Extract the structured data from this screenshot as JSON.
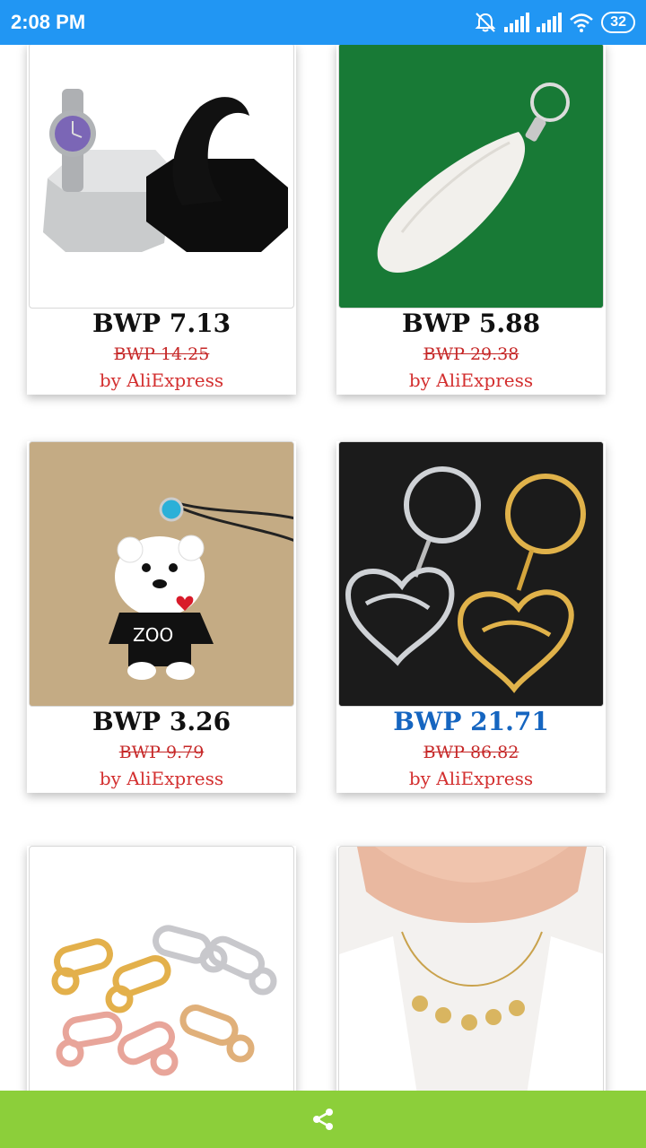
{
  "status_bar": {
    "time": "2:08 PM",
    "battery": "32",
    "icons": [
      "alarm-off-icon",
      "signal-icon",
      "signal-icon",
      "wifi-icon",
      "battery-icon"
    ]
  },
  "products": [
    {
      "price": "BWP 7.13",
      "old_price": "BWP 14.25",
      "seller": "by AliExpress",
      "image": "watch-display-stand"
    },
    {
      "price": "BWP 5.88",
      "old_price": "BWP 29.38",
      "seller": "by AliExpress",
      "image": "white-fur-tail-keychain"
    },
    {
      "price": "BWP 3.26",
      "old_price": "BWP 9.79",
      "seller": "by AliExpress",
      "image": "bear-zoo-charm"
    },
    {
      "price": "BWP 21.71",
      "old_price": "BWP 86.82",
      "seller": "by AliExpress",
      "image": "arabic-name-heart-keychains",
      "accent": "#1565c0"
    },
    {
      "price": "",
      "old_price": "",
      "seller": "",
      "image": "lobster-clasps"
    },
    {
      "price": "",
      "old_price": "",
      "seller": "",
      "image": "initial-disc-necklace"
    }
  ],
  "bottom_bar": {
    "icon": "share-icon"
  },
  "colors": {
    "status_bar": "#2196f3",
    "bottom_bar": "#8ccf3a",
    "old_price": "#c62828",
    "seller": "#d32f2f"
  }
}
